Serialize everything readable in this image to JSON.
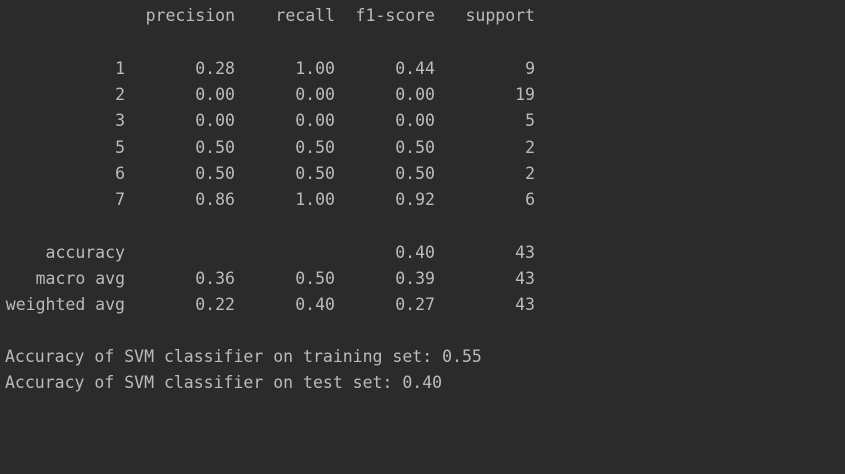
{
  "report": {
    "headers": [
      "precision",
      "recall",
      "f1-score",
      "support"
    ],
    "classes": [
      {
        "label": "1",
        "precision": "0.28",
        "recall": "1.00",
        "f1": "0.44",
        "support": "9"
      },
      {
        "label": "2",
        "precision": "0.00",
        "recall": "0.00",
        "f1": "0.00",
        "support": "19"
      },
      {
        "label": "3",
        "precision": "0.00",
        "recall": "0.00",
        "f1": "0.00",
        "support": "5"
      },
      {
        "label": "5",
        "precision": "0.50",
        "recall": "0.50",
        "f1": "0.50",
        "support": "2"
      },
      {
        "label": "6",
        "precision": "0.50",
        "recall": "0.50",
        "f1": "0.50",
        "support": "2"
      },
      {
        "label": "7",
        "precision": "0.86",
        "recall": "1.00",
        "f1": "0.92",
        "support": "6"
      }
    ],
    "averages": [
      {
        "label": "accuracy",
        "precision": "",
        "recall": "",
        "f1": "0.40",
        "support": "43"
      },
      {
        "label": "macro avg",
        "precision": "0.36",
        "recall": "0.50",
        "f1": "0.39",
        "support": "43"
      },
      {
        "label": "weighted avg",
        "precision": "0.22",
        "recall": "0.40",
        "f1": "0.27",
        "support": "43"
      }
    ]
  },
  "summary": [
    "Accuracy of SVM classifier on training set: 0.55",
    "Accuracy of SVM classifier on test set: 0.40"
  ],
  "colors": {
    "background": "#2b2b2b",
    "text": "#bbbbbb"
  }
}
